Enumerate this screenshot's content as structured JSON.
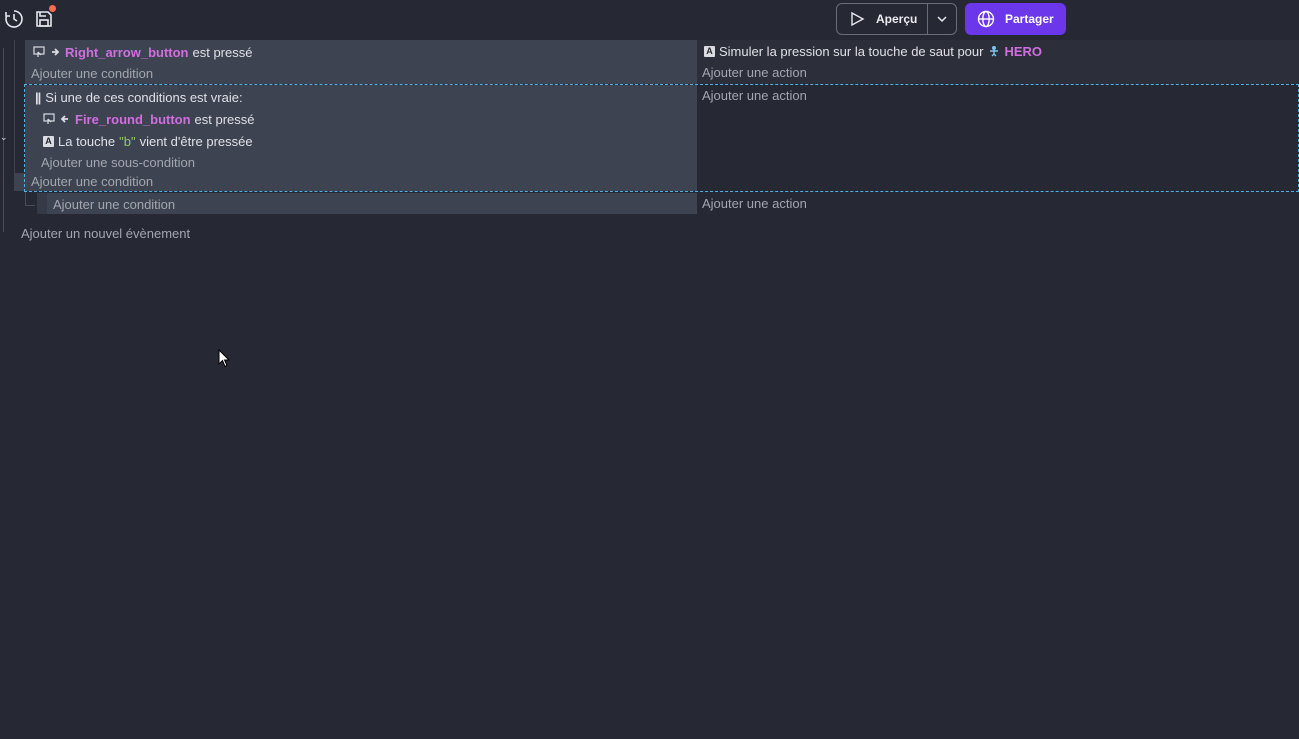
{
  "toolbar": {
    "history_icon": "history-icon",
    "save_icon": "save-icon",
    "preview_label": "Aperçu",
    "share_label": "Partager"
  },
  "event1": {
    "condition": {
      "object": "Right_arrow_button",
      "text": "est pressé"
    },
    "add_condition": "Ajouter une condition",
    "action": {
      "text": "Simuler la pression sur la touche de saut pour",
      "object": "HERO"
    },
    "add_action": "Ajouter une action"
  },
  "event2": {
    "or_label": "Si une de ces conditions est vraie:",
    "sub1": {
      "object": "Fire_round_button",
      "text": "est pressé"
    },
    "sub2": {
      "prefix": "La touche",
      "key": "\"b\"",
      "suffix": "vient d'être pressée"
    },
    "add_subcondition": "Ajouter une sous-condition",
    "add_condition": "Ajouter une condition",
    "add_action": "Ajouter une action"
  },
  "event3": {
    "add_condition": "Ajouter une condition",
    "add_action": "Ajouter une action"
  },
  "add_event": "Ajouter un nouvel évènement"
}
